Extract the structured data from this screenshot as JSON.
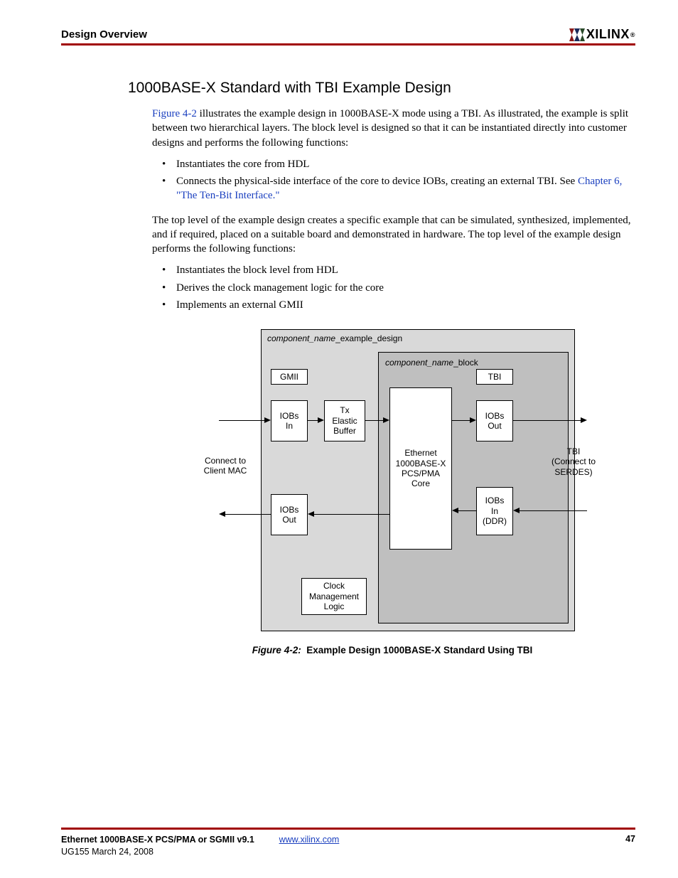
{
  "header": {
    "section": "Design Overview",
    "logo_text": "XILINX"
  },
  "section_heading": "1000BASE-X Standard with TBI Example Design",
  "para1_pre": "Figure 4-2",
  "para1_post": " illustrates the example design in 1000BASE-X mode using a TBI. As illustrated, the example is split between two hierarchical layers. The block level is designed so that it can be instantiated directly into customer designs and performs the following functions:",
  "list1": {
    "i0": "Instantiates the core from HDL",
    "i1_pre": "Connects the physical-side interface of the core to device IOBs, creating an external TBI. See ",
    "i1_link": "Chapter 6, \"The Ten-Bit Interface.\""
  },
  "para2": "The top level of the example design creates a specific example that can be simulated, synthesized, implemented, and if required, placed on a suitable board and demonstrated in hardware. The top level of the example design performs the following functions:",
  "list2": {
    "i0": "Instantiates the block level from HDL",
    "i1": "Derives the clock management logic for the core",
    "i2": "Implements an external GMII"
  },
  "diagram": {
    "outer_label_ital": "component_name",
    "outer_label_rest": "_example_design",
    "inner_label_ital": "component_name",
    "inner_label_rest": "_block",
    "gmii": "GMII",
    "tbi": "TBI",
    "iobs_in": "IOBs\nIn",
    "tx_elastic": "Tx\nElastic\nBuffer",
    "iobs_out_top": "IOBs\nOut",
    "core": "Ethernet\n1000BASE-X\nPCS/PMA\nCore",
    "iobs_out_bot": "IOBs\nOut",
    "iobs_in_ddr": "IOBs\nIn\n(DDR)",
    "clock_mgmt": "Clock\nManagement\nLogic",
    "left_label": "Connect to\nClient MAC",
    "right_label": "TBI\n(Connect to\nSERDES)"
  },
  "caption": {
    "ref": "Figure 4-2:",
    "title": "Example Design 1000BASE-X Standard Using TBI"
  },
  "footer": {
    "doc_title": "Ethernet 1000BASE-X PCS/PMA or SGMII v9.1",
    "doc_id": "UG155 March 24, 2008",
    "url": "www.xilinx.com",
    "page": "47"
  }
}
